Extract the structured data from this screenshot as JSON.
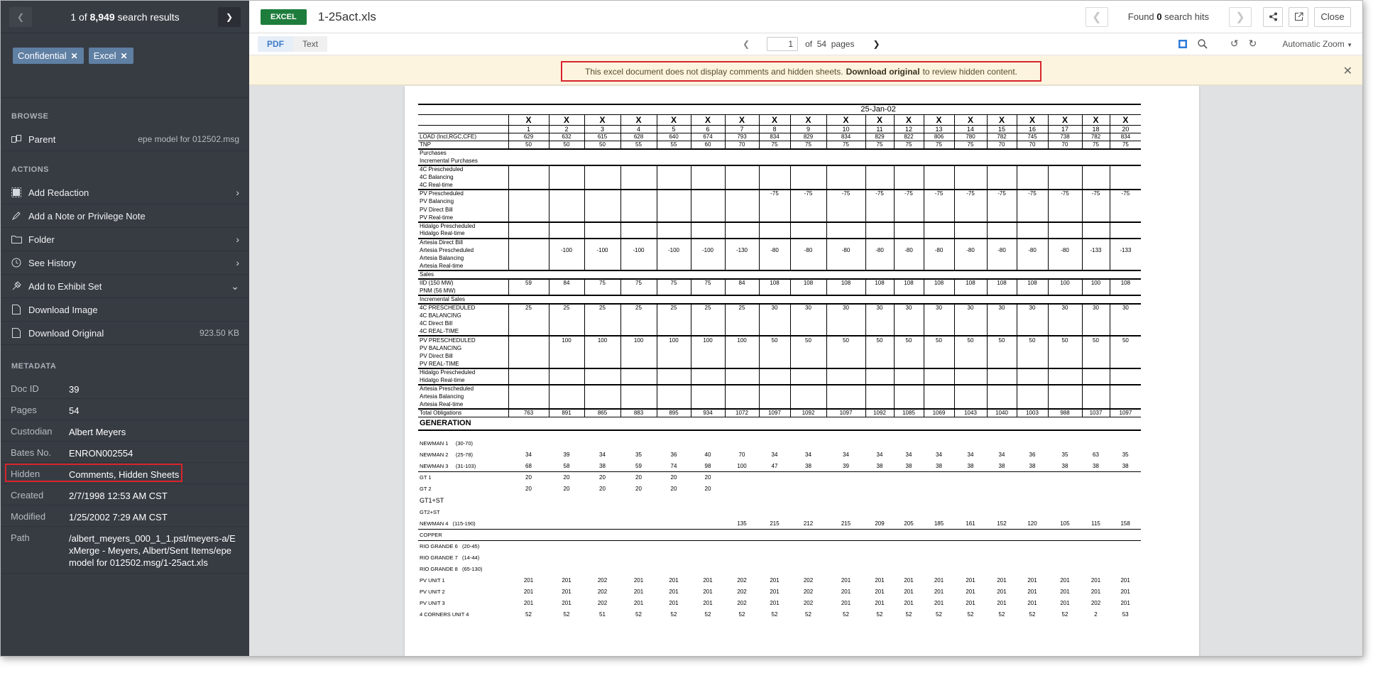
{
  "sidebar": {
    "results": {
      "prefix": "1 of ",
      "count": "8,949",
      "suffix": " search results"
    },
    "chips": [
      "Confidential",
      "Excel"
    ],
    "browse_title": "BROWSE",
    "parent": {
      "label": "Parent",
      "value": "epe model for 012502.msg"
    },
    "actions_title": "ACTIONS",
    "actions": [
      {
        "label": "Add Redaction",
        "icon": "redaction-icon",
        "chev": "›"
      },
      {
        "label": "Add a Note or Privilege Note",
        "icon": "note-icon",
        "chev": ""
      },
      {
        "label": "Folder",
        "icon": "folder-icon",
        "chev": "›"
      },
      {
        "label": "See History",
        "icon": "history-icon",
        "chev": "›"
      },
      {
        "label": "Add to Exhibit Set",
        "icon": "exhibit-icon",
        "chev": "⌄"
      },
      {
        "label": "Download Image",
        "icon": "image-file-icon",
        "chev": ""
      },
      {
        "label": "Download Original",
        "icon": "file-icon",
        "chev": "",
        "value": "923.50 KB"
      }
    ],
    "metadata_title": "METADATA",
    "metadata": [
      {
        "k": "Doc ID",
        "v": "39"
      },
      {
        "k": "Pages",
        "v": "54"
      },
      {
        "k": "Custodian",
        "v": "Albert Meyers"
      },
      {
        "k": "Bates No.",
        "v": "ENRON002554"
      },
      {
        "k": "Hidden",
        "v": "Comments, Hidden Sheets"
      },
      {
        "k": "Created",
        "v": "2/7/1998 12:53 AM CST"
      },
      {
        "k": "Modified",
        "v": "1/25/2002 7:29 AM CST"
      },
      {
        "k": "Path",
        "v": "/albert_meyers_000_1_1.pst/meyers-a/ExMerge - Meyers, Albert/Sent Items/epe model for 012502.msg/1-25act.xls"
      }
    ]
  },
  "header": {
    "badge": "EXCEL",
    "filename": "1-25act.xls",
    "hits": {
      "prefix": "Found ",
      "count": "0",
      "suffix": " search hits"
    },
    "close_label": "Close"
  },
  "toolbar": {
    "tab_pdf": "PDF",
    "tab_text": "Text",
    "page_value": "1",
    "page_total": "of  54  pages",
    "zoom": "Automatic Zoom"
  },
  "banner": {
    "text": "This excel document does not display comments and hidden sheets.",
    "link": "Download original",
    "suffix": "to review hidden content."
  },
  "sheet": {
    "date": "25-Jan-02",
    "x_row": [
      "X",
      "X",
      "X",
      "X",
      "X",
      "X",
      "X",
      "X",
      "X",
      "X",
      "X",
      "X",
      "X",
      "X",
      "X",
      "X",
      "X",
      "X",
      "X"
    ],
    "hours": [
      "1",
      "2",
      "3",
      "4",
      "5",
      "6",
      "7",
      "8",
      "9",
      "10",
      "11",
      "12",
      "13",
      "14",
      "15",
      "16",
      "17",
      "18",
      "20"
    ],
    "generation_label": "GENERATION"
  },
  "rows": [
    {
      "label": "LOAD (Incl,RGC,CFE)",
      "v": [
        "629",
        "632",
        "615",
        "628",
        "640",
        "674",
        "793",
        "834",
        "829",
        "834",
        "829",
        "822",
        "806",
        "780",
        "782",
        "745",
        "738",
        "782",
        "834"
      ]
    },
    {
      "label": "TNP",
      "v": [
        "50",
        "50",
        "50",
        "55",
        "55",
        "60",
        "70",
        "75",
        "75",
        "75",
        "75",
        "75",
        "75",
        "75",
        "70",
        "70",
        "70",
        "75",
        "75"
      ]
    },
    {
      "label": "Purchases",
      "v": []
    },
    {
      "label": "Incremental Purchases",
      "v": []
    },
    {
      "label": "4C Prescheduled",
      "v": []
    },
    {
      "label": "4C Balancing",
      "v": []
    },
    {
      "label": "4C Real-time",
      "v": []
    },
    {
      "label": "PV Prescheduled",
      "v": [
        "",
        "",
        "",
        "",
        "",
        "",
        "",
        "-75",
        "-75",
        "-75",
        "-75",
        "-75",
        "-75",
        "-75",
        "-75",
        "-75",
        "-75",
        "-75",
        "-75"
      ]
    },
    {
      "label": "PV Balancing",
      "v": []
    },
    {
      "label": "PV Direct Bill",
      "v": []
    },
    {
      "label": "PV Real-time",
      "v": []
    },
    {
      "label": "Hidalgo Prescheduled",
      "v": []
    },
    {
      "label": "Hidalgo Real-time",
      "v": []
    },
    {
      "label": "Artesia Direct Bill",
      "v": []
    },
    {
      "label": "Artesia Prescheduled",
      "v": [
        "",
        "-100",
        "-100",
        "-100",
        "-100",
        "-100",
        "-130",
        "-80",
        "-80",
        "-80",
        "-80",
        "-80",
        "-80",
        "-80",
        "-80",
        "-80",
        "-80",
        "-133",
        "-133"
      ]
    },
    {
      "label": "Artesia Balancing",
      "v": []
    },
    {
      "label": "Artesia Real-time",
      "v": []
    },
    {
      "label": "Sales",
      "v": []
    },
    {
      "label": "IID (150 MW)",
      "v": [
        "59",
        "84",
        "75",
        "75",
        "75",
        "75",
        "84",
        "108",
        "108",
        "108",
        "108",
        "108",
        "108",
        "108",
        "108",
        "108",
        "100",
        "100",
        "108"
      ]
    },
    {
      "label": "PNM (56 MW)",
      "v": []
    },
    {
      "label": "Incremental Sales",
      "v": []
    },
    {
      "label": "4C PRESCHEDULED",
      "v": [
        "25",
        "25",
        "25",
        "25",
        "25",
        "25",
        "25",
        "30",
        "30",
        "30",
        "30",
        "30",
        "30",
        "30",
        "30",
        "30",
        "30",
        "30",
        "30"
      ]
    },
    {
      "label": "4C BALANCING",
      "v": []
    },
    {
      "label": "4C Direct Bill",
      "v": []
    },
    {
      "label": "4C REAL-TIME",
      "v": []
    },
    {
      "label": "PV PRESCHEDULED",
      "v": [
        "",
        "100",
        "100",
        "100",
        "100",
        "100",
        "100",
        "50",
        "50",
        "50",
        "50",
        "50",
        "50",
        "50",
        "50",
        "50",
        "50",
        "50",
        "50"
      ]
    },
    {
      "label": "PV BALANCING",
      "v": []
    },
    {
      "label": "PV Direct Bill",
      "v": []
    },
    {
      "label": "PV REAL-TIME",
      "v": []
    },
    {
      "label": "Hidalgo Prescheduled",
      "v": []
    },
    {
      "label": "Hidalgo Real-time",
      "v": []
    },
    {
      "label": "Artesia Prescheduled",
      "v": []
    },
    {
      "label": "Artesia Balancing",
      "v": []
    },
    {
      "label": "Artesia Real-time",
      "v": []
    },
    {
      "label": "Total Obligations",
      "v": [
        "763",
        "891",
        "865",
        "883",
        "895",
        "934",
        "1072",
        "1097",
        "1092",
        "1097",
        "1092",
        "1085",
        "1069",
        "1043",
        "1040",
        "1003",
        "988",
        "1037",
        "1097"
      ]
    }
  ],
  "gen_rows": [
    {
      "label": "",
      "v": []
    },
    {
      "label": "NEWMAN 1     (30-70)",
      "v": []
    },
    {
      "label": "NEWMAN 2     (25-78)",
      "v": [
        "34",
        "39",
        "34",
        "35",
        "36",
        "40",
        "70",
        "34",
        "34",
        "34",
        "34",
        "34",
        "34",
        "34",
        "34",
        "36",
        "35",
        "63",
        "35"
      ]
    },
    {
      "label": "NEWMAN 3     (31-103)",
      "v": [
        "68",
        "58",
        "38",
        "59",
        "74",
        "98",
        "100",
        "47",
        "38",
        "39",
        "38",
        "38",
        "38",
        "38",
        "38",
        "38",
        "38",
        "38",
        "38"
      ]
    },
    {
      "label": "GT 1",
      "v": [
        "20",
        "20",
        "20",
        "20",
        "20",
        "20"
      ]
    },
    {
      "label": "GT 2",
      "v": [
        "20",
        "20",
        "20",
        "20",
        "20",
        "20"
      ]
    },
    {
      "label": "GT1+ST",
      "v": []
    },
    {
      "label": "GT2+ST",
      "v": []
    },
    {
      "label": "NEWMAN 4   (115-190)",
      "v": [
        "",
        "",
        "",
        "",
        "",
        "",
        "135",
        "215",
        "212",
        "215",
        "209",
        "205",
        "185",
        "161",
        "152",
        "120",
        "105",
        "115",
        "158"
      ]
    },
    {
      "label": "COPPER",
      "v": []
    },
    {
      "label": "RIO GRANDE 6   (20-45)",
      "v": []
    },
    {
      "label": "RIO GRANDE 7   (14-44)",
      "v": []
    },
    {
      "label": "RIO GRANDE 8   (65-130)",
      "v": []
    },
    {
      "label": "PV UNIT 1",
      "v": [
        "201",
        "201",
        "202",
        "201",
        "201",
        "201",
        "202",
        "201",
        "202",
        "201",
        "201",
        "201",
        "201",
        "201",
        "201",
        "201",
        "201",
        "201",
        "201"
      ]
    },
    {
      "label": "PV UNIT 2",
      "v": [
        "201",
        "201",
        "202",
        "201",
        "201",
        "201",
        "202",
        "201",
        "202",
        "201",
        "201",
        "201",
        "201",
        "201",
        "201",
        "201",
        "201",
        "201",
        "201"
      ]
    },
    {
      "label": "PV UNIT 3",
      "v": [
        "201",
        "201",
        "202",
        "201",
        "201",
        "201",
        "202",
        "201",
        "202",
        "201",
        "201",
        "201",
        "201",
        "201",
        "201",
        "201",
        "201",
        "202",
        "201"
      ]
    },
    {
      "label": "4 CORNERS UNIT 4",
      "v": [
        "52",
        "52",
        "51",
        "52",
        "52",
        "52",
        "52",
        "52",
        "52",
        "52",
        "52",
        "52",
        "52",
        "52",
        "52",
        "52",
        "52",
        "2",
        "53"
      ]
    }
  ]
}
